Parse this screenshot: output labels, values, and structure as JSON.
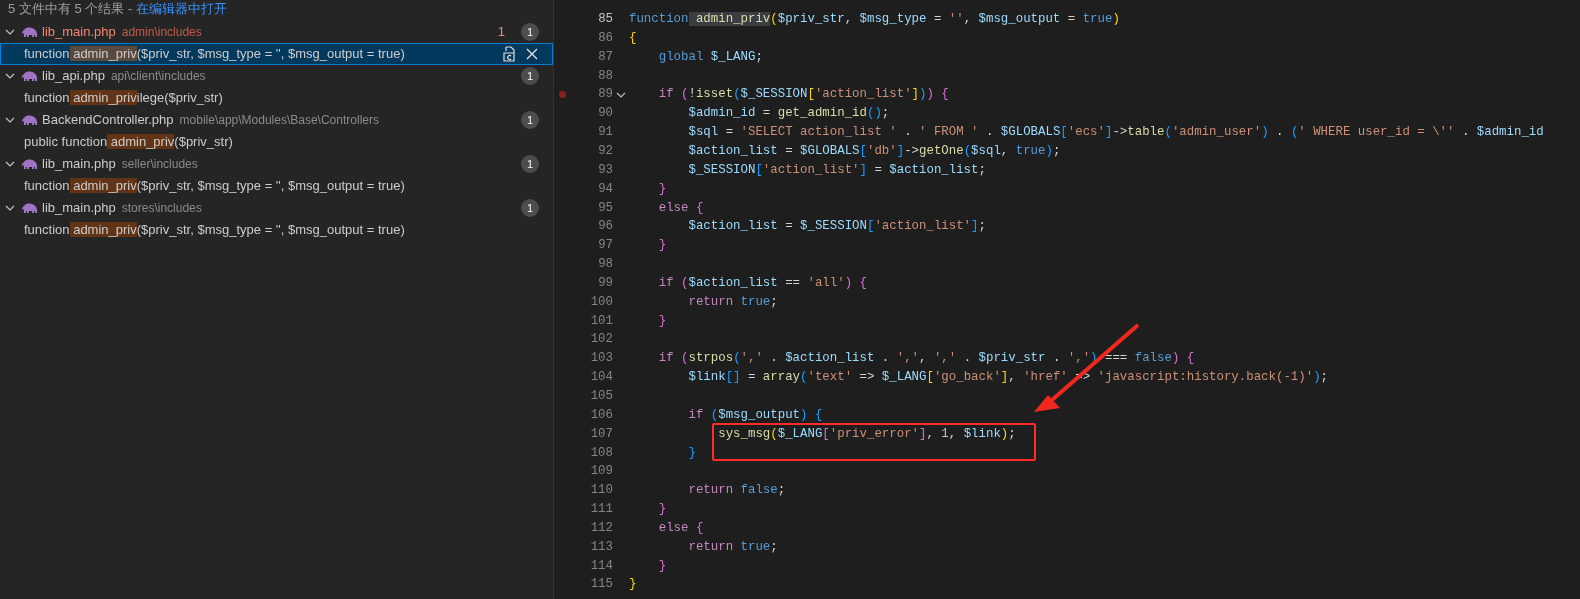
{
  "search_results": {
    "summary": "5 文件中有 5 个结果 -",
    "open_in_editor": "在编辑器中打开",
    "files": [
      {
        "name": "lib_main.php",
        "path": "admin\\includes",
        "error": true,
        "problems": "1",
        "count": "1",
        "expanded": true,
        "matches": [
          {
            "before": "function",
            "match": " admin_priv",
            "after": "($priv_str, $msg_type = '', $msg_output = true)",
            "selected": true
          }
        ]
      },
      {
        "name": "lib_api.php",
        "path": "api\\client\\includes",
        "error": false,
        "count": "1",
        "expanded": true,
        "matches": [
          {
            "before": "function",
            "match": " admin_priv",
            "after": "ilege($priv_str)",
            "selected": false
          }
        ]
      },
      {
        "name": "BackendController.php",
        "path": "mobile\\app\\Modules\\Base\\Controllers",
        "error": false,
        "count": "1",
        "expanded": true,
        "matches": [
          {
            "before": "public function",
            "match": " admin_priv",
            "after": "($priv_str)",
            "selected": false
          }
        ]
      },
      {
        "name": "lib_main.php",
        "path": "seller\\includes",
        "error": false,
        "count": "1",
        "expanded": true,
        "matches": [
          {
            "before": "function",
            "match": " admin_priv",
            "after": "($priv_str, $msg_type = '', $msg_output = true)",
            "selected": false
          }
        ]
      },
      {
        "name": "lib_main.php",
        "path": "stores\\includes",
        "error": false,
        "count": "1",
        "expanded": true,
        "matches": [
          {
            "before": "function",
            "match": " admin_priv",
            "after": "($priv_str, $msg_type = '', $msg_output = true)",
            "selected": false
          }
        ]
      }
    ]
  },
  "editor": {
    "lines": [
      {
        "number": "85",
        "current": true,
        "breakpoint": false,
        "foldable": false,
        "tokens": [
          {
            "kind": "kw",
            "text": "function"
          },
          {
            "kind": "match",
            "text": " admin_priv"
          },
          {
            "kind": "b1",
            "text": "("
          },
          {
            "kind": "var",
            "text": "$priv_str"
          },
          {
            "kind": "op",
            "text": ", "
          },
          {
            "kind": "var",
            "text": "$msg_type"
          },
          {
            "kind": "op",
            "text": " = "
          },
          {
            "kind": "str",
            "text": "''"
          },
          {
            "kind": "op",
            "text": ", "
          },
          {
            "kind": "var",
            "text": "$msg_output"
          },
          {
            "kind": "op",
            "text": " = "
          },
          {
            "kind": "kw",
            "text": "true"
          },
          {
            "kind": "b1",
            "text": ")"
          }
        ]
      },
      {
        "number": "86",
        "current": false,
        "breakpoint": false,
        "foldable": false,
        "tokens": [
          {
            "kind": "b1",
            "text": "{"
          }
        ]
      },
      {
        "number": "87",
        "current": false,
        "breakpoint": false,
        "foldable": false,
        "tokens": [
          {
            "kind": "kw",
            "text": "    global "
          },
          {
            "kind": "var",
            "text": "$_LANG"
          },
          {
            "kind": "op",
            "text": ";"
          }
        ]
      },
      {
        "number": "88",
        "current": false,
        "breakpoint": false,
        "foldable": false
      },
      {
        "number": "89",
        "current": false,
        "breakpoint": true,
        "foldable": true,
        "tokens": [
          {
            "kind": "ctrl",
            "text": "    if "
          },
          {
            "kind": "b2",
            "text": "("
          },
          {
            "kind": "op",
            "text": "!"
          },
          {
            "kind": "fn",
            "text": "isset"
          },
          {
            "kind": "b3",
            "text": "("
          },
          {
            "kind": "var",
            "text": "$_SESSION"
          },
          {
            "kind": "b1",
            "text": "["
          },
          {
            "kind": "str",
            "text": "'action_list'"
          },
          {
            "kind": "b1",
            "text": "]"
          },
          {
            "kind": "b3",
            "text": ")"
          },
          {
            "kind": "b2",
            "text": ")"
          },
          {
            "kind": "b2",
            "text": " {"
          }
        ]
      },
      {
        "number": "90",
        "current": false,
        "breakpoint": false,
        "foldable": false,
        "tokens": [
          {
            "kind": "var",
            "text": "        $admin_id"
          },
          {
            "kind": "op",
            "text": " = "
          },
          {
            "kind": "fn",
            "text": "get_admin_id"
          },
          {
            "kind": "b3",
            "text": "()"
          },
          {
            "kind": "op",
            "text": ";"
          }
        ]
      },
      {
        "number": "91",
        "current": false,
        "breakpoint": false,
        "foldable": false,
        "tokens": [
          {
            "kind": "var",
            "text": "        $sql"
          },
          {
            "kind": "op",
            "text": " = "
          },
          {
            "kind": "str",
            "text": "'SELECT action_list '"
          },
          {
            "kind": "op",
            "text": " . "
          },
          {
            "kind": "str",
            "text": "' FROM '"
          },
          {
            "kind": "op",
            "text": " . "
          },
          {
            "kind": "var",
            "text": "$GLOBALS"
          },
          {
            "kind": "b3",
            "text": "["
          },
          {
            "kind": "str",
            "text": "'ecs'"
          },
          {
            "kind": "b3",
            "text": "]"
          },
          {
            "kind": "op",
            "text": "->"
          },
          {
            "kind": "fn",
            "text": "table"
          },
          {
            "kind": "b3",
            "text": "("
          },
          {
            "kind": "str",
            "text": "'admin_user'"
          },
          {
            "kind": "b3",
            "text": ")"
          },
          {
            "kind": "op",
            "text": " . "
          },
          {
            "kind": "b3",
            "text": "("
          },
          {
            "kind": "str",
            "text": "' WHERE user_id = \\''"
          },
          {
            "kind": "op",
            "text": " . "
          },
          {
            "kind": "var",
            "text": "$admin_id"
          }
        ]
      },
      {
        "number": "92",
        "current": false,
        "breakpoint": false,
        "foldable": false,
        "tokens": [
          {
            "kind": "var",
            "text": "        $action_list"
          },
          {
            "kind": "op",
            "text": " = "
          },
          {
            "kind": "var",
            "text": "$GLOBALS"
          },
          {
            "kind": "b3",
            "text": "["
          },
          {
            "kind": "str",
            "text": "'db'"
          },
          {
            "kind": "b3",
            "text": "]"
          },
          {
            "kind": "op",
            "text": "->"
          },
          {
            "kind": "fn",
            "text": "getOne"
          },
          {
            "kind": "b3",
            "text": "("
          },
          {
            "kind": "var",
            "text": "$sql"
          },
          {
            "kind": "op",
            "text": ", "
          },
          {
            "kind": "kw",
            "text": "true"
          },
          {
            "kind": "b3",
            "text": ")"
          },
          {
            "kind": "op",
            "text": ";"
          }
        ]
      },
      {
        "number": "93",
        "current": false,
        "breakpoint": false,
        "foldable": false,
        "tokens": [
          {
            "kind": "var",
            "text": "        $_SESSION"
          },
          {
            "kind": "b3",
            "text": "["
          },
          {
            "kind": "str",
            "text": "'action_list'"
          },
          {
            "kind": "b3",
            "text": "]"
          },
          {
            "kind": "op",
            "text": " = "
          },
          {
            "kind": "var",
            "text": "$action_list"
          },
          {
            "kind": "op",
            "text": ";"
          }
        ]
      },
      {
        "number": "94",
        "current": false,
        "breakpoint": false,
        "foldable": false,
        "tokens": [
          {
            "kind": "b2",
            "text": "    }"
          }
        ]
      },
      {
        "number": "95",
        "current": false,
        "breakpoint": false,
        "foldable": false,
        "tokens": [
          {
            "kind": "ctrl",
            "text": "    else "
          },
          {
            "kind": "b2",
            "text": "{"
          }
        ]
      },
      {
        "number": "96",
        "current": false,
        "breakpoint": false,
        "foldable": false,
        "tokens": [
          {
            "kind": "var",
            "text": "        $action_list"
          },
          {
            "kind": "op",
            "text": " = "
          },
          {
            "kind": "var",
            "text": "$_SESSION"
          },
          {
            "kind": "b3",
            "text": "["
          },
          {
            "kind": "str",
            "text": "'action_list'"
          },
          {
            "kind": "b3",
            "text": "]"
          },
          {
            "kind": "op",
            "text": ";"
          }
        ]
      },
      {
        "number": "97",
        "current": false,
        "breakpoint": false,
        "foldable": false,
        "tokens": [
          {
            "kind": "b2",
            "text": "    }"
          }
        ]
      },
      {
        "number": "98",
        "current": false,
        "breakpoint": false,
        "foldable": false
      },
      {
        "number": "99",
        "current": false,
        "breakpoint": false,
        "foldable": false,
        "tokens": [
          {
            "kind": "ctrl",
            "text": "    if "
          },
          {
            "kind": "b2",
            "text": "("
          },
          {
            "kind": "var",
            "text": "$action_list"
          },
          {
            "kind": "op",
            "text": " == "
          },
          {
            "kind": "str",
            "text": "'all'"
          },
          {
            "kind": "b2",
            "text": ")"
          },
          {
            "kind": "b2",
            "text": " {"
          }
        ]
      },
      {
        "number": "100",
        "current": false,
        "breakpoint": false,
        "foldable": false,
        "tokens": [
          {
            "kind": "ctrl",
            "text": "        return "
          },
          {
            "kind": "kw",
            "text": "true"
          },
          {
            "kind": "op",
            "text": ";"
          }
        ]
      },
      {
        "number": "101",
        "current": false,
        "breakpoint": false,
        "foldable": false,
        "tokens": [
          {
            "kind": "b2",
            "text": "    }"
          }
        ]
      },
      {
        "number": "102",
        "current": false,
        "breakpoint": false,
        "foldable": false
      },
      {
        "number": "103",
        "current": false,
        "breakpoint": false,
        "foldable": false,
        "tokens": [
          {
            "kind": "ctrl",
            "text": "    if "
          },
          {
            "kind": "b2",
            "text": "("
          },
          {
            "kind": "fn",
            "text": "strpos"
          },
          {
            "kind": "b3",
            "text": "("
          },
          {
            "kind": "str",
            "text": "','"
          },
          {
            "kind": "op",
            "text": " . "
          },
          {
            "kind": "var",
            "text": "$action_list"
          },
          {
            "kind": "op",
            "text": " . "
          },
          {
            "kind": "str",
            "text": "','"
          },
          {
            "kind": "op",
            "text": ", "
          },
          {
            "kind": "str",
            "text": "','"
          },
          {
            "kind": "op",
            "text": " . "
          },
          {
            "kind": "var",
            "text": "$priv_str"
          },
          {
            "kind": "op",
            "text": " . "
          },
          {
            "kind": "str",
            "text": "','"
          },
          {
            "kind": "b3",
            "text": ")"
          },
          {
            "kind": "op",
            "text": " === "
          },
          {
            "kind": "kw",
            "text": "false"
          },
          {
            "kind": "b2",
            "text": ")"
          },
          {
            "kind": "b2",
            "text": " {"
          }
        ]
      },
      {
        "number": "104",
        "current": false,
        "breakpoint": false,
        "foldable": false,
        "tokens": [
          {
            "kind": "var",
            "text": "        $link"
          },
          {
            "kind": "b3",
            "text": "[]"
          },
          {
            "kind": "op",
            "text": " = "
          },
          {
            "kind": "fn",
            "text": "array"
          },
          {
            "kind": "b3",
            "text": "("
          },
          {
            "kind": "str",
            "text": "'text'"
          },
          {
            "kind": "op",
            "text": " => "
          },
          {
            "kind": "var",
            "text": "$_LANG"
          },
          {
            "kind": "b1",
            "text": "["
          },
          {
            "kind": "str",
            "text": "'go_back'"
          },
          {
            "kind": "b1",
            "text": "]"
          },
          {
            "kind": "op",
            "text": ", "
          },
          {
            "kind": "str",
            "text": "'href'"
          },
          {
            "kind": "op",
            "text": " => "
          },
          {
            "kind": "str",
            "text": "'javascript:history.back(-1)'"
          },
          {
            "kind": "b3",
            "text": ")"
          },
          {
            "kind": "op",
            "text": ";"
          }
        ]
      },
      {
        "number": "105",
        "current": false,
        "breakpoint": false,
        "foldable": false
      },
      {
        "number": "106",
        "current": false,
        "breakpoint": false,
        "foldable": false,
        "tokens": [
          {
            "kind": "ctrl",
            "text": "        if "
          },
          {
            "kind": "b3",
            "text": "("
          },
          {
            "kind": "var",
            "text": "$msg_output"
          },
          {
            "kind": "b3",
            "text": ")"
          },
          {
            "kind": "b3",
            "text": " {"
          }
        ]
      },
      {
        "number": "107",
        "current": false,
        "breakpoint": false,
        "foldable": false,
        "tokens": [
          {
            "kind": "fn",
            "text": "            sys_msg"
          },
          {
            "kind": "b1",
            "text": "("
          },
          {
            "kind": "var",
            "text": "$_LANG"
          },
          {
            "kind": "b2",
            "text": "["
          },
          {
            "kind": "str",
            "text": "'priv_error'"
          },
          {
            "kind": "b2",
            "text": "]"
          },
          {
            "kind": "op",
            "text": ", "
          },
          {
            "kind": "num",
            "text": "1"
          },
          {
            "kind": "op",
            "text": ", "
          },
          {
            "kind": "var",
            "text": "$link"
          },
          {
            "kind": "b1",
            "text": ")"
          },
          {
            "kind": "op",
            "text": ";"
          }
        ]
      },
      {
        "number": "108",
        "current": false,
        "breakpoint": false,
        "foldable": false,
        "tokens": [
          {
            "kind": "b3",
            "text": "        }"
          }
        ]
      },
      {
        "number": "109",
        "current": false,
        "breakpoint": false,
        "foldable": false
      },
      {
        "number": "110",
        "current": false,
        "breakpoint": false,
        "foldable": false,
        "tokens": [
          {
            "kind": "ctrl",
            "text": "        return "
          },
          {
            "kind": "kw",
            "text": "false"
          },
          {
            "kind": "op",
            "text": ";"
          }
        ]
      },
      {
        "number": "111",
        "current": false,
        "breakpoint": false,
        "foldable": false,
        "tokens": [
          {
            "kind": "b2",
            "text": "    }"
          }
        ]
      },
      {
        "number": "112",
        "current": false,
        "breakpoint": false,
        "foldable": false,
        "tokens": [
          {
            "kind": "ctrl",
            "text": "    else "
          },
          {
            "kind": "b2",
            "text": "{"
          }
        ]
      },
      {
        "number": "113",
        "current": false,
        "breakpoint": false,
        "foldable": false,
        "tokens": [
          {
            "kind": "ctrl",
            "text": "        return "
          },
          {
            "kind": "kw",
            "text": "true"
          },
          {
            "kind": "op",
            "text": ";"
          }
        ]
      },
      {
        "number": "114",
        "current": false,
        "breakpoint": false,
        "foldable": false,
        "tokens": [
          {
            "kind": "b2",
            "text": "    }"
          }
        ]
      },
      {
        "number": "115",
        "current": false,
        "breakpoint": false,
        "foldable": false,
        "tokens": [
          {
            "kind": "b1",
            "text": "}"
          }
        ]
      }
    ]
  }
}
